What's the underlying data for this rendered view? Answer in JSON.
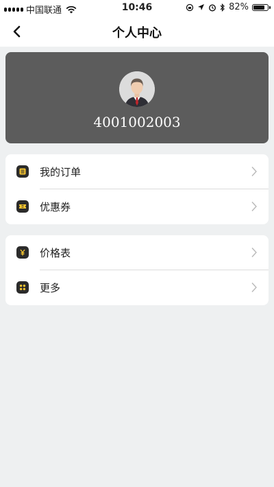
{
  "status_bar": {
    "carrier": "中国联通",
    "time": "10:46",
    "battery_percent": "82%",
    "battery_level": 0.82,
    "icons": [
      "signal-icon",
      "wifi-icon",
      "rotation-lock-icon",
      "location-icon",
      "alarm-icon",
      "bluetooth-icon",
      "battery-icon"
    ]
  },
  "nav": {
    "title": "个人中心",
    "back_icon": "back-arrow-icon"
  },
  "profile": {
    "user_id": "4001002003",
    "avatar_icon": "avatar-businessman"
  },
  "menu_group_1": [
    {
      "label": "我的订单",
      "icon": "order-icon"
    },
    {
      "label": "优惠券",
      "icon": "coupon-icon"
    }
  ],
  "menu_group_2": [
    {
      "label": "价格表",
      "icon": "yen-icon"
    },
    {
      "label": "更多",
      "icon": "more-icon"
    }
  ],
  "colors": {
    "accent": "#f6c530",
    "profile_bg": "#5c5c5c",
    "page_bg": "#eef0f1",
    "icon_bg": "#2b2b2b"
  }
}
